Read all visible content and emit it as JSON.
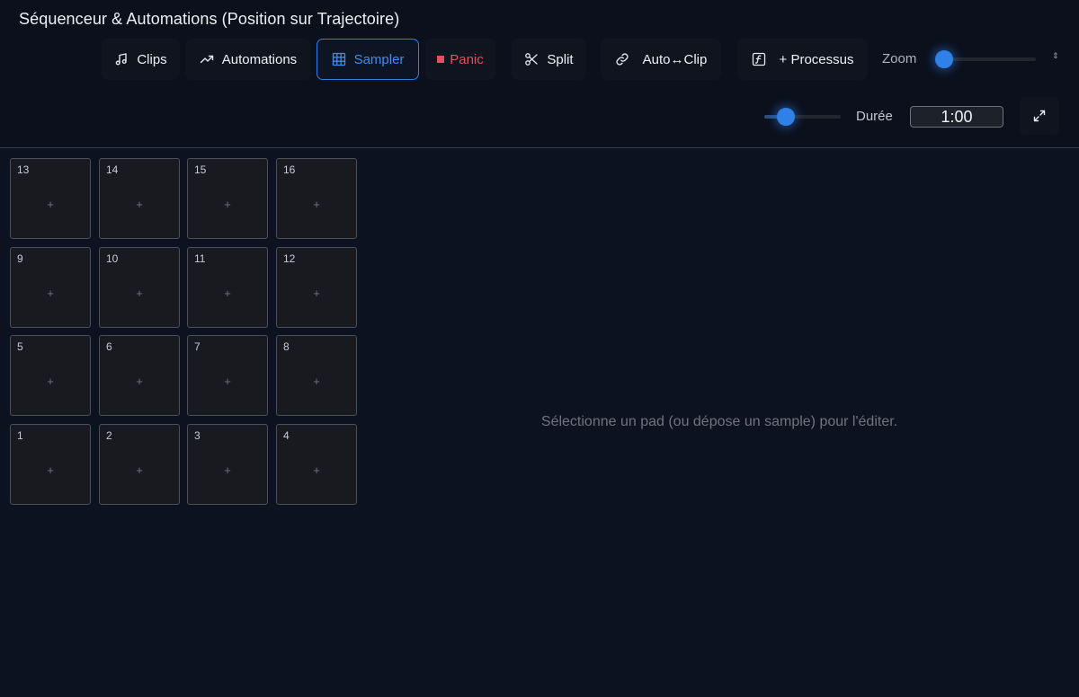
{
  "header": {
    "title": "Séquenceur & Automations (Position sur Trajectoire)"
  },
  "toolbar": {
    "clips_label": "Clips",
    "automations_label": "Automations",
    "sampler_label": "Sampler",
    "panic_label": "Panic",
    "split_label": "Split",
    "autoclip_label": "Auto↔Clip",
    "processus_label": "+ Processus",
    "active_tab": "Sampler",
    "accent_color": "#2f80e8",
    "panic_color": "#e0525f"
  },
  "zoom": {
    "label": "Zoom",
    "level": 0.0,
    "arrows": "⇕"
  },
  "duration": {
    "label": "Durée",
    "value": "1:00",
    "slider_level": 0.3
  },
  "sampler": {
    "pads": [
      [
        "13",
        "14",
        "15",
        "16"
      ],
      [
        "9",
        "10",
        "11",
        "12"
      ],
      [
        "5",
        "6",
        "7",
        "8"
      ],
      [
        "1",
        "2",
        "3",
        "4"
      ]
    ],
    "pad_add_symbol": "+",
    "empty_message": "Sélectionne un pad (ou dépose un sample) pour l'éditer."
  }
}
